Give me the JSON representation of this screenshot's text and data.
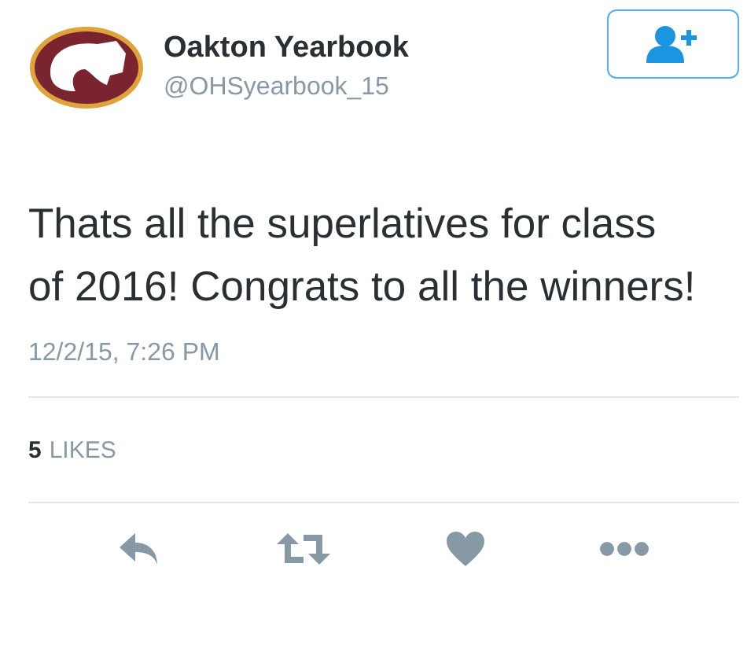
{
  "account": {
    "name": "Oakton Yearbook",
    "handle": "@OHSyearbook_15"
  },
  "tweet": {
    "text": "Thats all the superlatives for class of 2016! Congrats to all the winners!",
    "timestamp": "12/2/15, 7:26 PM"
  },
  "stats": {
    "count": "5",
    "label": "LIKES"
  },
  "actions": [
    {
      "kind": "reply"
    },
    {
      "kind": "retweet"
    },
    {
      "kind": "like"
    },
    {
      "kind": "more"
    }
  ]
}
